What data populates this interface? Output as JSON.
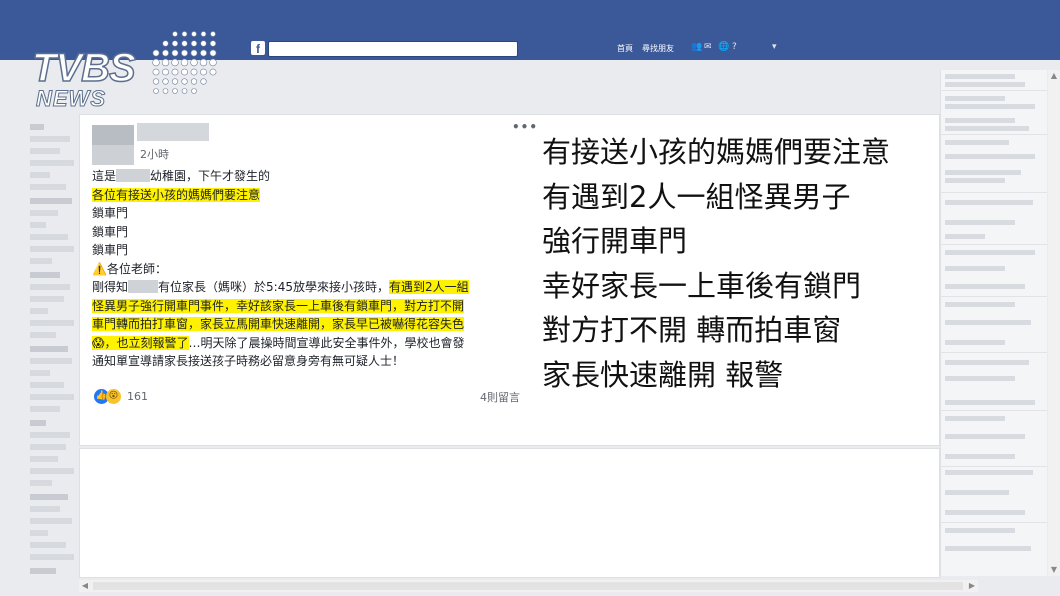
{
  "topbar": {
    "logo_glyph": "f",
    "nav_home": "首頁",
    "nav_find_friends": "尋找朋友",
    "icons": [
      "friend-requests-icon",
      "messages-icon",
      "notifications-icon",
      "help-icon",
      "account-menu-icon"
    ],
    "icon_glyphs": [
      "👥",
      "✉",
      "🌐",
      "?"
    ],
    "account_glyph": "▾"
  },
  "watermark": {
    "line1": "TVBS",
    "line2": "NEWS"
  },
  "post": {
    "timestamp": "2小時",
    "more": "•••",
    "lines": [
      {
        "pre": "這是",
        "post": "幼稚園，下午才發生的"
      },
      {
        "hl": "各位有接送小孩的媽媽們要注意"
      },
      {
        "text": "鎖車門"
      },
      {
        "text": "鎖車門"
      },
      {
        "text": "鎖車門"
      },
      {
        "text": "⚠️各位老師："
      },
      {
        "pre": "剛得知",
        "mid": "有位家長（媽咪）於5:45放學來接小孩時，",
        "hl": "有遇到2人一組"
      },
      {
        "hl": "怪異男子強行開車門事件，幸好該家長一上車後有鎖車門，對方打不開"
      },
      {
        "hl": "車門轉而拍打車窗，家長立馬開車快速離開，家長早已被嚇得花容失色"
      },
      {
        "hl": "😱，也立刻報警了",
        "post": "…明天除了晨操時間宣導此安全事件外，學校也會發"
      },
      {
        "text": "通知單宣導請家長接送孩子時務必留意身旁有無可疑人士！"
      }
    ],
    "reactions": {
      "like_glyph": "👍",
      "wow_glyph": "😮",
      "count": "161"
    },
    "comments": "4則留言"
  },
  "caption": {
    "lines": [
      "有接送小孩的媽媽們要注意",
      "有遇到2人一組怪異男子",
      "強行開車門",
      "幸好家長一上車後有鎖門",
      "對方打不開 轉而拍車窗",
      "家長快速離開 報警"
    ]
  },
  "colors": {
    "facebook_blue": "#3b5998",
    "highlight": "#fff200",
    "page_bg": "#e9ebee"
  },
  "scrollbars": {
    "up": "▲",
    "down": "▼",
    "left": "◀",
    "right": "▶"
  }
}
